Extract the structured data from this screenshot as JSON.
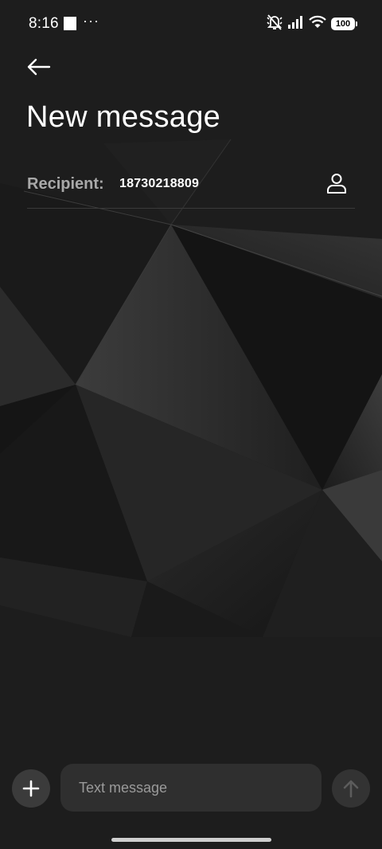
{
  "status_bar": {
    "time": "8:16",
    "more_indicator": "···",
    "battery": "100",
    "icons": [
      "notification-square-icon",
      "vibrate-mute-icon",
      "signal-icon",
      "wifi-icon",
      "battery-icon"
    ]
  },
  "header": {
    "back_icon": "back-arrow-icon",
    "title": "New message"
  },
  "recipient": {
    "label": "Recipient:",
    "value": "18730218809",
    "contact_icon": "person-icon"
  },
  "compose": {
    "placeholder": "Text message",
    "value": "",
    "attach_icon": "plus-icon",
    "send_icon": "arrow-up-icon"
  },
  "colors": {
    "background": "#1d1d1d",
    "label_gray": "#a8a8a8",
    "input_bg": "#2f2f2f",
    "button_bg": "#3b3b3b",
    "send_disabled": "#5c5c5c"
  }
}
